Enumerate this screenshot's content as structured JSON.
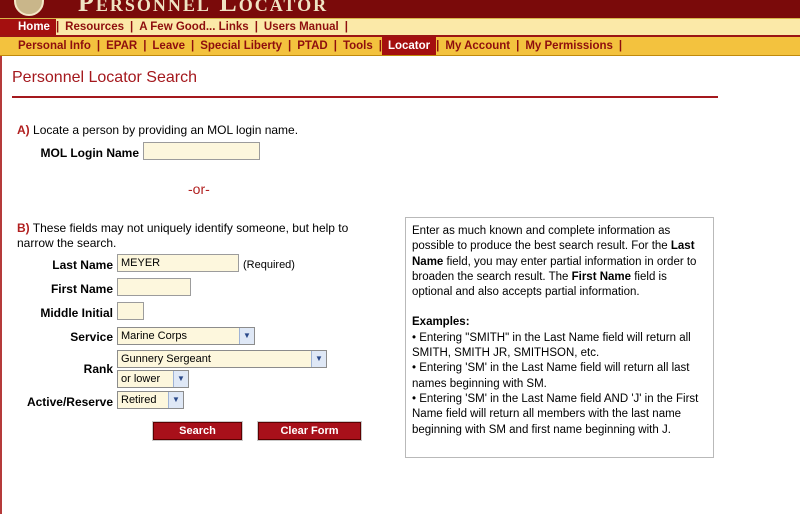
{
  "header": {
    "logo_text": "Personnel Locator"
  },
  "nav_primary": [
    {
      "label": "Home",
      "active": true
    },
    {
      "label": "Resources",
      "active": false
    },
    {
      "label": "A Few Good... Links",
      "active": false
    },
    {
      "label": "Users Manual",
      "active": false
    }
  ],
  "nav_secondary": [
    {
      "label": "Personal Info",
      "active": false
    },
    {
      "label": "EPAR",
      "active": false
    },
    {
      "label": "Leave",
      "active": false
    },
    {
      "label": "Special Liberty",
      "active": false
    },
    {
      "label": "PTAD",
      "active": false
    },
    {
      "label": "Tools",
      "active": false
    },
    {
      "label": "Locator",
      "active": true
    },
    {
      "label": "My Account",
      "active": false
    },
    {
      "label": "My Permissions",
      "active": false
    }
  ],
  "separator": "|",
  "page": {
    "title": "Personnel Locator Search"
  },
  "section_a": {
    "letter": "A)",
    "text": "Locate a person by providing an MOL login name.",
    "mol_login_label": "MOL Login Name",
    "mol_login_value": ""
  },
  "or_text": "-or-",
  "section_b": {
    "letter": "B)",
    "text_line1": "These fields may not uniquely identify someone, but help to",
    "text_line2": "narrow the search.",
    "last_name_label": "Last Name",
    "last_name_value": "MEYER",
    "required_note": "(Required)",
    "first_name_label": "First Name",
    "first_name_value": "",
    "middle_initial_label": "Middle Initial",
    "middle_initial_value": "",
    "service_label": "Service",
    "service_value": "Marine Corps",
    "rank_label": "Rank",
    "rank_value": "Gunnery Sergeant",
    "rank_modifier_value": "or lower",
    "active_reserve_label": "Active/Reserve",
    "active_reserve_value": "Retired"
  },
  "buttons": {
    "search": "Search",
    "clear": "Clear Form"
  },
  "help": {
    "p1_a": "Enter as much known and complete information as possible to produce the best search result. For the ",
    "p1_b": "Last Name",
    "p1_c": " field, you may enter partial information in order to broaden the search result. The ",
    "p1_d": "First Name",
    "p1_e": " field is optional and also accepts partial information.",
    "examples_title": "Examples:",
    "ex1": "• Entering \"SMITH\" in the Last Name field will return all SMITH, SMITH JR, SMITHSON, etc.",
    "ex2": "• Entering 'SM' in the Last Name field will return all last names beginning with SM.",
    "ex3": "• Entering 'SM' in the Last Name field AND 'J' in the First Name field will return all members with the last name beginning with SM and first name beginning with J."
  },
  "icons": {
    "dropdown": "chevron-down-icon",
    "seal": "seal-logo"
  },
  "colors": {
    "accent_red": "#a4181d",
    "nav_gold": "#f3c23e",
    "nav_cream": "#fbe9a8",
    "input_bg": "#fdf7dd"
  }
}
